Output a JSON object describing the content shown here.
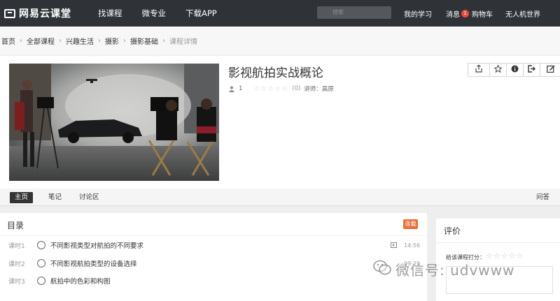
{
  "header": {
    "logo_text": "网易云课堂",
    "nav": [
      "找课程",
      "微专业",
      "下载APP"
    ],
    "search_placeholder": "搜索",
    "my_study": "我的学习",
    "messages": "消息",
    "message_count": "1",
    "cart": "购物车",
    "username": "无人机世界"
  },
  "breadcrumb": {
    "items": [
      "首页",
      "全部课程",
      "兴趣生活",
      "摄影",
      "摄影基础"
    ],
    "current": "课程详情"
  },
  "course": {
    "title": "影视航拍实战概论",
    "students": "1",
    "stars": "☆☆☆☆☆",
    "review_count": "(0)",
    "lecturer_label": "讲师：",
    "lecturer_name": "高原",
    "actions": [
      "share-icon",
      "star-icon",
      "info-icon",
      "exit-icon",
      "edit-icon"
    ]
  },
  "tabs": {
    "home": "主页",
    "notes": "笔记",
    "forum": "讨论区",
    "qa": "问答"
  },
  "catalog": {
    "title": "目录",
    "status_badge": "连载",
    "lessons": [
      {
        "num": "课时1",
        "name": "不同影视类型对航拍的不同要求",
        "duration": "14:56"
      },
      {
        "num": "课时2",
        "name": "不同影视航拍类型的设备选择",
        "duration": "09:29"
      },
      {
        "num": "课时3",
        "name": "航拍中的色彩和构图",
        "duration": ""
      }
    ]
  },
  "rating": {
    "title": "评价",
    "label": "给该课程打分：",
    "stars": "☆☆☆☆☆"
  },
  "watermark": {
    "text": "微信号: udvwww"
  },
  "colors": {
    "topbar": "#2f3237",
    "badge_red": "#e74c3c",
    "serial_orange": "#e8703a"
  }
}
